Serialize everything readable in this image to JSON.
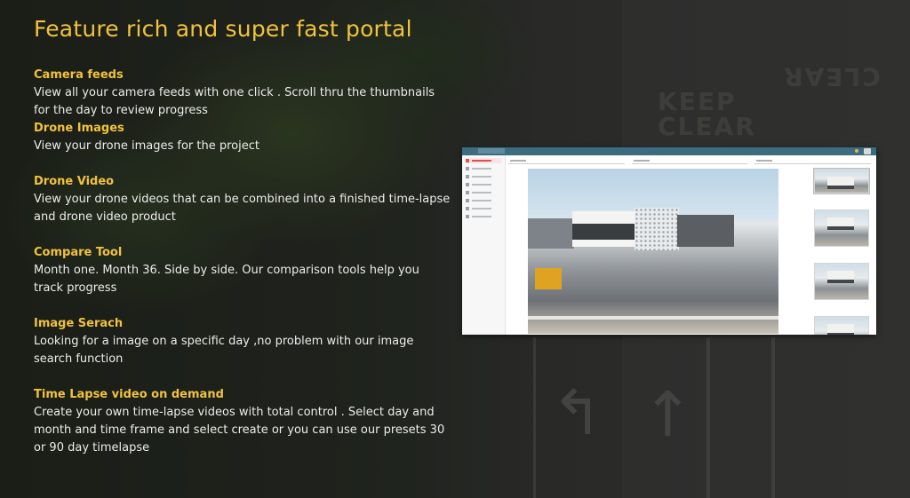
{
  "page": {
    "title": "Feature rich and super fast portal"
  },
  "features": [
    {
      "heading": "Camera feeds",
      "text": "View all your camera feeds with one click . Scroll thru the thumbnails for the day to review progress"
    },
    {
      "heading": "Drone Images",
      "text": "View your drone images for the project"
    },
    {
      "heading": "Drone Video",
      "text": "View your drone videos that can be combined into a finished time-lapse and drone video product"
    },
    {
      "heading": "Compare Tool",
      "text": "Month one. Month 36. Side by side. Our comparison tools help you track progress"
    },
    {
      "heading": "Image Serach",
      "text": "Looking for a image on a specific day ,no problem with our image search function"
    },
    {
      "heading": "Time Lapse video on demand",
      "text": "Create your own time-lapse videos with total control . Select day and month and time frame and select create or you can use our presets 30 or 90 day timelapse"
    }
  ],
  "colors": {
    "heading_accent": "#f2c23c",
    "body_text": "#ececea",
    "app_topbar": "#3b6c82"
  },
  "icons": {
    "app_menu": "hamburger-icon",
    "app_user": "user-avatar-icon",
    "app_notification": "bell-icon"
  }
}
